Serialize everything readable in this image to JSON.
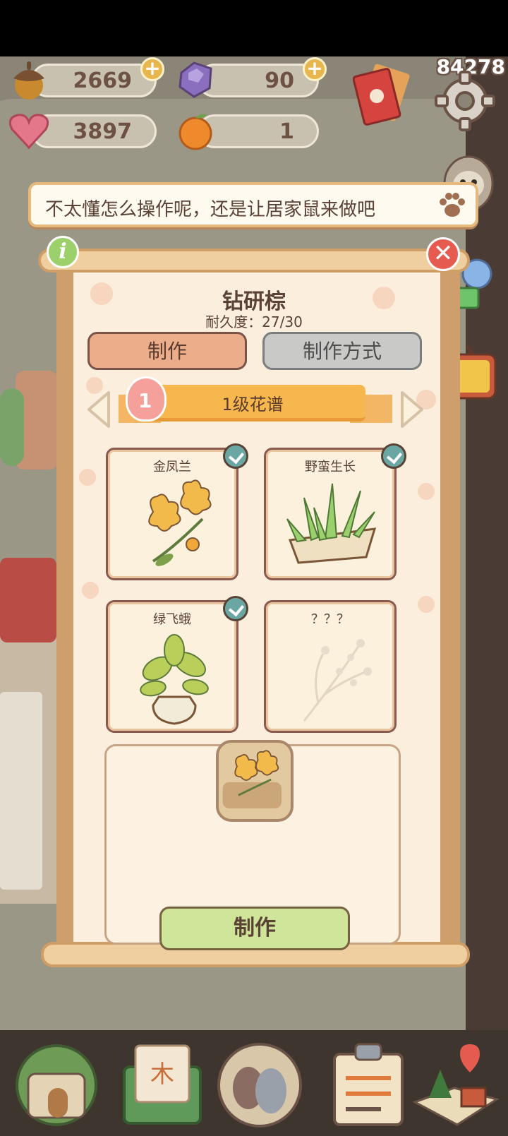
{
  "resources": {
    "acorns": {
      "value": "2669",
      "icon": "acorn-icon"
    },
    "gems": {
      "value": "90",
      "icon": "purple-gem-icon"
    },
    "hearts": {
      "value": "3897",
      "icon": "heart-icon"
    },
    "oranges": {
      "value": "1",
      "icon": "orange-icon"
    }
  },
  "fps_counter": "84278",
  "hint": {
    "text": "不太懂怎么操作呢，还是让居家鼠来做吧"
  },
  "tool": {
    "name": "钻研棕",
    "durability": "耐久度：27/30"
  },
  "tabs": {
    "make": "制作",
    "method": "制作方式"
  },
  "recipe_level": {
    "badge": "1",
    "title": "1级花谱"
  },
  "recipes": [
    {
      "name": "金凤兰",
      "unlocked": true
    },
    {
      "name": "野蛮生长",
      "unlocked": true
    },
    {
      "name": "绿飞蛾",
      "unlocked": true
    },
    {
      "name": "？？？",
      "unlocked": false
    }
  ],
  "make_button": "制作",
  "colors": {
    "accent_orange": "#f6b84e",
    "make_green": "#cfe59a",
    "close_red": "#e65b50",
    "check_teal": "#6aa7a2"
  },
  "nav_icons": [
    "house-icon",
    "mail-icon",
    "eggs-icon",
    "checklist-icon",
    "map-icon"
  ]
}
